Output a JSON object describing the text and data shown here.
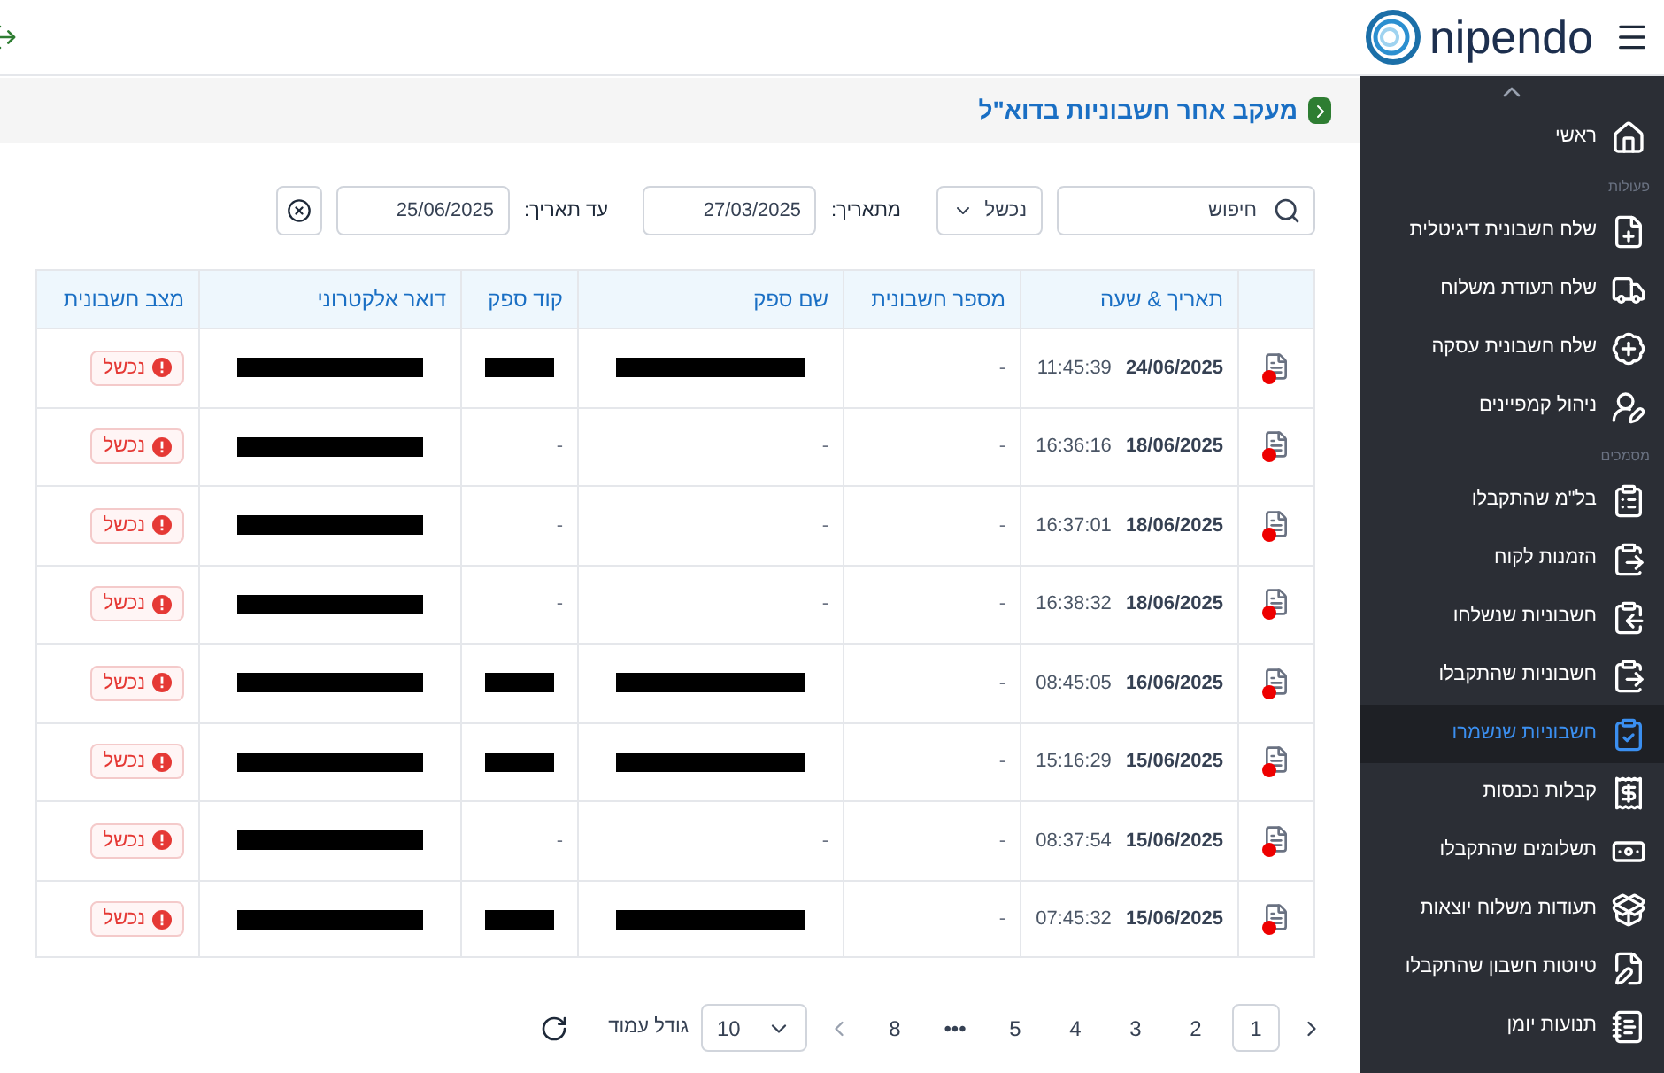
{
  "header": {
    "logo_text": "nipendo"
  },
  "page_title": "מעקב אחר חשבוניות בדוא\"ל",
  "filters": {
    "search": {
      "placeholder": "חיפוש"
    },
    "status": {
      "value": "נכשל"
    },
    "from_label": "מתאריך:",
    "from_date": "27/03/2025",
    "to_label": "עד תאריך:",
    "to_date": "25/06/2025"
  },
  "table": {
    "columns": [
      "תאריך & שעה",
      "מספר חשבונית",
      "שם ספק",
      "קוד ספק",
      "דואר אלקטרוני",
      "מצב חשבונית"
    ],
    "rows": [
      {
        "date": "24/06/2025",
        "time": "11:45:39",
        "invoice_number": "-",
        "supplier_name": {
          "redacted": true
        },
        "supplier_code": {
          "redacted": true
        },
        "email": {
          "redacted": true
        },
        "status": {
          "kind": "failed",
          "label": "נכשל"
        }
      },
      {
        "date": "18/06/2025",
        "time": "16:36:16",
        "invoice_number": "-",
        "supplier_name": "-",
        "supplier_code": "-",
        "email": {
          "redacted": true
        },
        "status": {
          "kind": "failed",
          "label": "נכשל"
        }
      },
      {
        "date": "18/06/2025",
        "time": "16:37:01",
        "invoice_number": "-",
        "supplier_name": "-",
        "supplier_code": "-",
        "email": {
          "redacted": true
        },
        "status": {
          "kind": "failed",
          "label": "נכשל"
        }
      },
      {
        "date": "18/06/2025",
        "time": "16:38:32",
        "invoice_number": "-",
        "supplier_name": "-",
        "supplier_code": "-",
        "email": {
          "redacted": true
        },
        "status": {
          "kind": "failed",
          "label": "נכשל"
        }
      },
      {
        "date": "16/06/2025",
        "time": "08:45:05",
        "invoice_number": "-",
        "supplier_name": {
          "redacted": true
        },
        "supplier_code": {
          "redacted": true
        },
        "email": {
          "redacted": true
        },
        "status": {
          "kind": "failed",
          "label": "נכשל"
        }
      },
      {
        "date": "15/06/2025",
        "time": "15:16:29",
        "invoice_number": "-",
        "supplier_name": {
          "redacted": true
        },
        "supplier_code": {
          "redacted": true
        },
        "email": {
          "redacted": true
        },
        "status": {
          "kind": "failed",
          "label": "נכשל"
        }
      },
      {
        "date": "15/06/2025",
        "time": "08:37:54",
        "invoice_number": "-",
        "supplier_name": "-",
        "supplier_code": "-",
        "email": {
          "redacted": true
        },
        "status": {
          "kind": "failed",
          "label": "נכשל"
        }
      },
      {
        "date": "15/06/2025",
        "time": "07:45:32",
        "invoice_number": "-",
        "supplier_name": {
          "redacted": true
        },
        "supplier_code": {
          "redacted": true
        },
        "email": {
          "redacted": true
        },
        "status": {
          "kind": "failed",
          "label": "נכשל"
        }
      }
    ]
  },
  "pagination": {
    "pages": [
      {
        "label": "1",
        "selected": true
      },
      {
        "label": "2",
        "selected": false
      },
      {
        "label": "3",
        "selected": false
      },
      {
        "label": "4",
        "selected": false
      },
      {
        "label": "5",
        "selected": false
      },
      {
        "label": "•••",
        "selected": false
      },
      {
        "label": "8",
        "selected": false
      }
    ],
    "page_size": "10",
    "page_size_label": "גודל עמוד"
  },
  "sidebar": {
    "items": [
      {
        "kind": "item",
        "label": "ראשי",
        "selected": false
      },
      {
        "kind": "section",
        "label": "פעולות"
      },
      {
        "kind": "item",
        "label": "שלח חשבונית דיגיטלית",
        "selected": false
      },
      {
        "kind": "item",
        "label": "שלח תעודת משלוח",
        "selected": false
      },
      {
        "kind": "item",
        "label": "שלח חשבונית עסקה",
        "selected": false
      },
      {
        "kind": "item",
        "label": "ניהול קמפיינים",
        "selected": false
      },
      {
        "kind": "section",
        "label": "מסמכים"
      },
      {
        "kind": "item",
        "label": "בל\"מ שהתקבלו",
        "selected": false
      },
      {
        "kind": "item",
        "label": "הזמנות לקוח",
        "selected": false
      },
      {
        "kind": "item",
        "label": "חשבוניות שנשלחו",
        "selected": false
      },
      {
        "kind": "item",
        "label": "חשבוניות שהתקבלו",
        "selected": false
      },
      {
        "kind": "item",
        "label": "חשבוניות שנשמרו",
        "selected": true
      },
      {
        "kind": "item",
        "label": "קבלות נכנסות",
        "selected": false
      },
      {
        "kind": "item",
        "label": "תשלומים שהתקבלו",
        "selected": false
      },
      {
        "kind": "item",
        "label": "תעודות משלוח יוצאות",
        "selected": false
      },
      {
        "kind": "item",
        "label": "טיוטות חשבון שהתקבלו",
        "selected": false
      },
      {
        "kind": "item",
        "label": "תנועות יומן",
        "selected": false
      }
    ]
  }
}
